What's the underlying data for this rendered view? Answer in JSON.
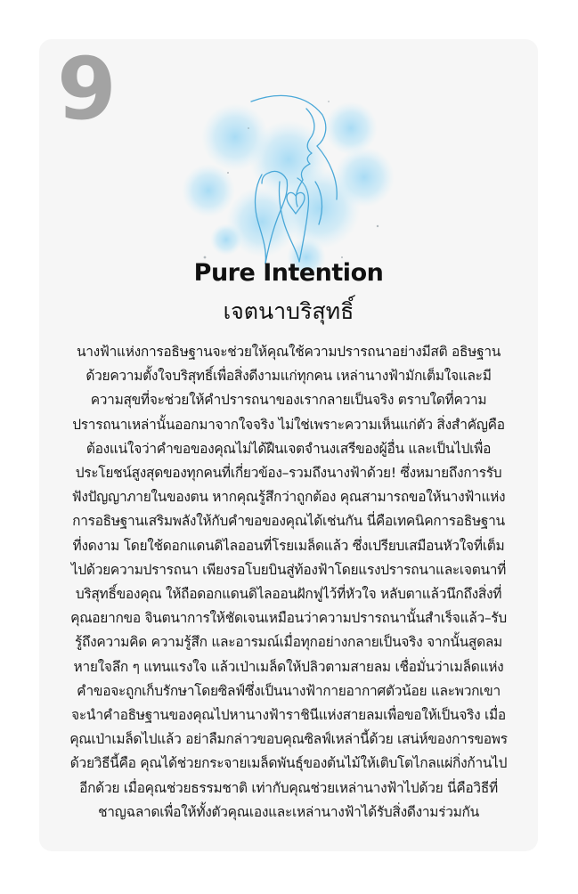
{
  "card": {
    "number": "9",
    "title": "Pure Intention",
    "subtitle": "เจตนาบริสุทธิ์",
    "body": "นางฟ้าแห่งการอธิษฐานจะช่วยให้คุณใช้ความปรารถนาอย่างมีสติ อธิษฐานด้วยความตั้งใจบริสุทธิ์เพื่อสิ่งดีงามแก่ทุกคน เหล่านางฟ้ามักเต็มใจและมีความสุขที่จะช่วยให้คำปรารถนาของเรากลายเป็นจริง ตราบใดที่ความปรารถนาเหล่านั้นออกมาจากใจจริง ไม่ใช่เพราะความเห็นแก่ตัว สิ่งสำคัญคือต้องแน่ใจว่าคำขอของคุณไม่ได้ฝืนเจตจำนงเสรีของผู้อื่น และเป็นไปเพื่อประโยชน์สูงสุดของทุกคนที่เกี่ยวข้อง–รวมถึงนางฟ้าด้วย! ซึ่งหมายถึงการรับฟังปัญญาภายในของตน หากคุณรู้สึกว่าถูกต้อง คุณสามารถขอให้นางฟ้าแห่งการอธิษฐานเสริมพลังให้กับคำขอของคุณได้เช่นกัน นี่คือเทคนิคการอธิษฐานที่งดงาม โดยใช้ดอกแดนดิไลออนที่โรยเมล็ดแล้ว ซึ่งเปรียบเสมือนหัวใจที่เต็มไปด้วยความปรารถนา เพียงรอโบยบินสู่ท้องฟ้าโดยแรงปรารถนาและเจตนาที่บริสุทธิ์ของคุณ ให้ถือดอกแดนดิไลออนฝักฟูไว้ที่หัวใจ หลับตาแล้วนึกถึงสิ่งที่คุณอยากขอ จินตนาการให้ชัดเจนเหมือนว่าความปรารถนานั้นสำเร็จแล้ว–รับรู้ถึงความคิด ความรู้สึก และอารมณ์เมื่อทุกอย่างกลายเป็นจริง จากนั้นสูดลมหายใจลึก ๆ แทนแรงใจ แล้วเป่าเมล็ดให้ปลิวตามสายลม เชื่อมั่นว่าเมล็ดแห่งคำขอจะถูกเก็บรักษาโดยซิลฟ์ซึ่งเป็นนางฟ้ากายอากาศตัวน้อย และพวกเขาจะนำคำอธิษฐานของคุณไปหานางฟ้าราชินีแห่งสายลมเพื่อขอให้เป็นจริง เมื่อคุณเป่าเมล็ดไปแล้ว อย่าลืมกล่าวขอบคุณซิลฟ์เหล่านี้ด้วย เสน่ห์ของการขอพรด้วยวิธีนี้คือ คุณได้ช่วยกระจายเมล็ดพันธุ์ของต้นไม้ให้เติบโตไกลแผ่กิ่งก้านไปอีกด้วย เมื่อคุณช่วยธรรมชาติ เท่ากับคุณช่วยเหล่านางฟ้าไปด้วย นี่คือวิธีที่ชาญฉลาดเพื่อให้ทั้งตัวคุณเองและเหล่านางฟ้าได้รับสิ่งดีงามร่วมกัน"
  },
  "colors": {
    "card_background": "#f6f6f6",
    "number_color": "#a3a3a3",
    "illustration_line": "#4aa8d8",
    "watercolor": "#8fd3f4"
  },
  "icons": {
    "illustration": "praying-angel-illustration"
  }
}
